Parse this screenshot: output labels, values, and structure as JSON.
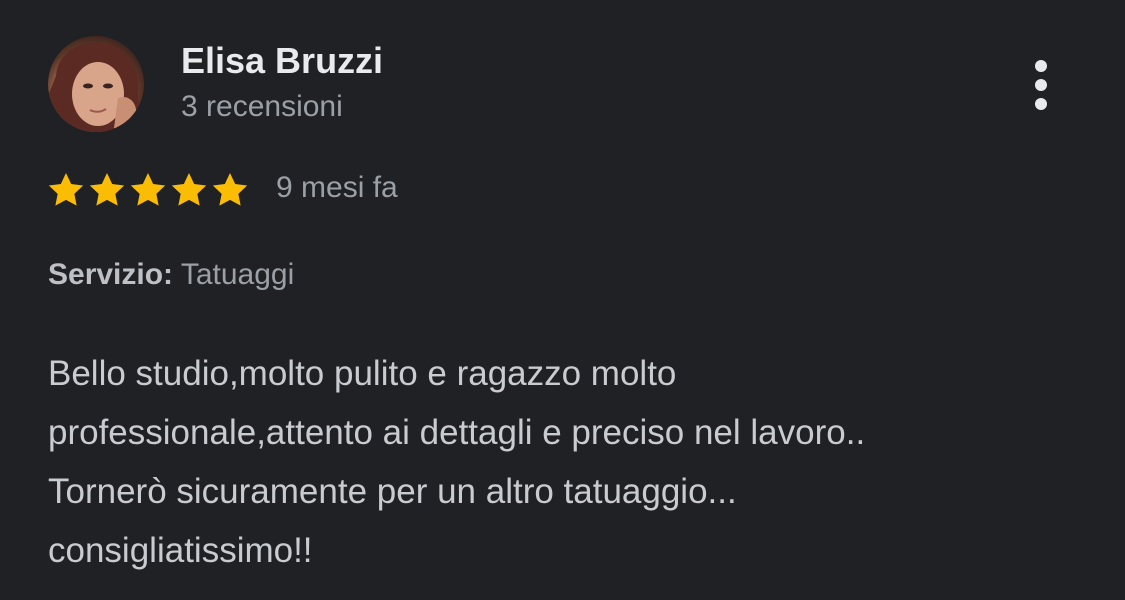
{
  "review": {
    "author": {
      "name": "Elisa Bruzzi",
      "reviews_count": "3 recensioni",
      "avatar": "profile-photo"
    },
    "menu_icon": "more-vert-icon",
    "rating": 5,
    "rating_max": 5,
    "star_color": "#fbbc04",
    "time_ago": "9 mesi fa",
    "service": {
      "label": "Servizio:",
      "value": "Tatuaggi"
    },
    "text_lines": [
      "Bello studio,molto pulito e ragazzo molto",
      "professionale,attento ai dettagli e preciso nel lavoro..",
      "Tornerò sicuramente per un altro tatuaggio...",
      "consigliatissimo!!"
    ]
  },
  "colors": {
    "background": "#202124",
    "primary_text": "#e8eaed",
    "secondary_text": "#9aa0a6"
  }
}
